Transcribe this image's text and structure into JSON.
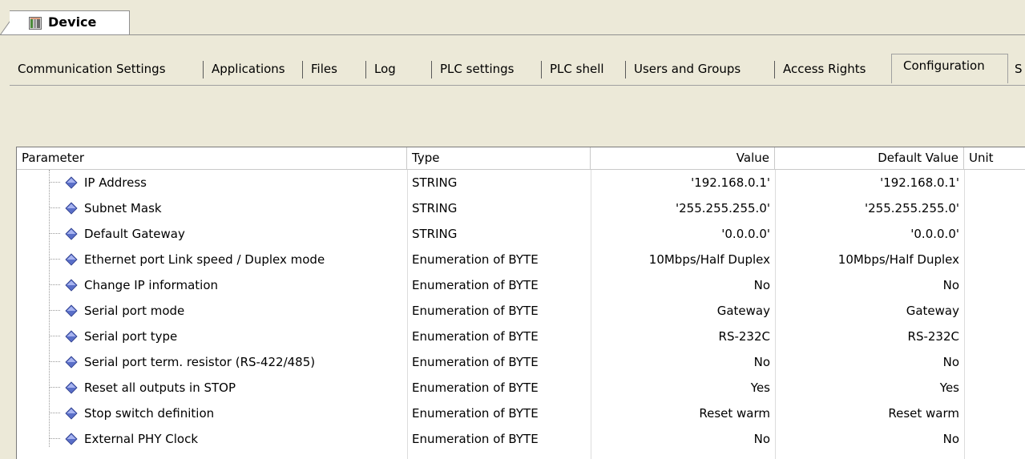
{
  "document_tab": {
    "title": "Device",
    "icon": "device-icon"
  },
  "tabs": [
    {
      "label": "Communication Settings",
      "active": false
    },
    {
      "label": "Applications",
      "active": false
    },
    {
      "label": "Files",
      "active": false
    },
    {
      "label": "Log",
      "active": false
    },
    {
      "label": "PLC settings",
      "active": false
    },
    {
      "label": "PLC shell",
      "active": false
    },
    {
      "label": "Users and Groups",
      "active": false
    },
    {
      "label": "Access Rights",
      "active": false
    },
    {
      "label": "Configuration",
      "active": true
    },
    {
      "label": "S",
      "active": false
    }
  ],
  "table": {
    "headers": {
      "parameter": "Parameter",
      "type": "Type",
      "value": "Value",
      "default_value": "Default Value",
      "unit": "Unit"
    },
    "rows": [
      {
        "parameter": "IP Address",
        "type": "STRING",
        "value": "'192.168.0.1'",
        "default_value": "'192.168.0.1'",
        "unit": ""
      },
      {
        "parameter": "Subnet Mask",
        "type": "STRING",
        "value": "'255.255.255.0'",
        "default_value": "'255.255.255.0'",
        "unit": ""
      },
      {
        "parameter": "Default Gateway",
        "type": "STRING",
        "value": "'0.0.0.0'",
        "default_value": "'0.0.0.0'",
        "unit": ""
      },
      {
        "parameter": "Ethernet port Link speed / Duplex mode",
        "type": "Enumeration of BYTE",
        "value": "10Mbps/Half Duplex",
        "default_value": "10Mbps/Half Duplex",
        "unit": ""
      },
      {
        "parameter": "Change IP information",
        "type": "Enumeration of BYTE",
        "value": "No",
        "default_value": "No",
        "unit": ""
      },
      {
        "parameter": "Serial port mode",
        "type": "Enumeration of BYTE",
        "value": "Gateway",
        "default_value": "Gateway",
        "unit": ""
      },
      {
        "parameter": "Serial port type",
        "type": "Enumeration of BYTE",
        "value": "RS-232C",
        "default_value": "RS-232C",
        "unit": ""
      },
      {
        "parameter": "Serial port term. resistor (RS-422/485)",
        "type": "Enumeration of BYTE",
        "value": "No",
        "default_value": "No",
        "unit": ""
      },
      {
        "parameter": "Reset all outputs in STOP",
        "type": "Enumeration of BYTE",
        "value": "Yes",
        "default_value": "Yes",
        "unit": ""
      },
      {
        "parameter": "Stop switch definition",
        "type": "Enumeration of BYTE",
        "value": "Reset warm",
        "default_value": "Reset warm",
        "unit": ""
      },
      {
        "parameter": "External PHY Clock",
        "type": "Enumeration of BYTE",
        "value": "No",
        "default_value": "No",
        "unit": ""
      }
    ]
  },
  "colors": {
    "panel_bg": "#ece9d8",
    "grid_bg": "#ffffff",
    "gem": "#5a6fc8"
  }
}
